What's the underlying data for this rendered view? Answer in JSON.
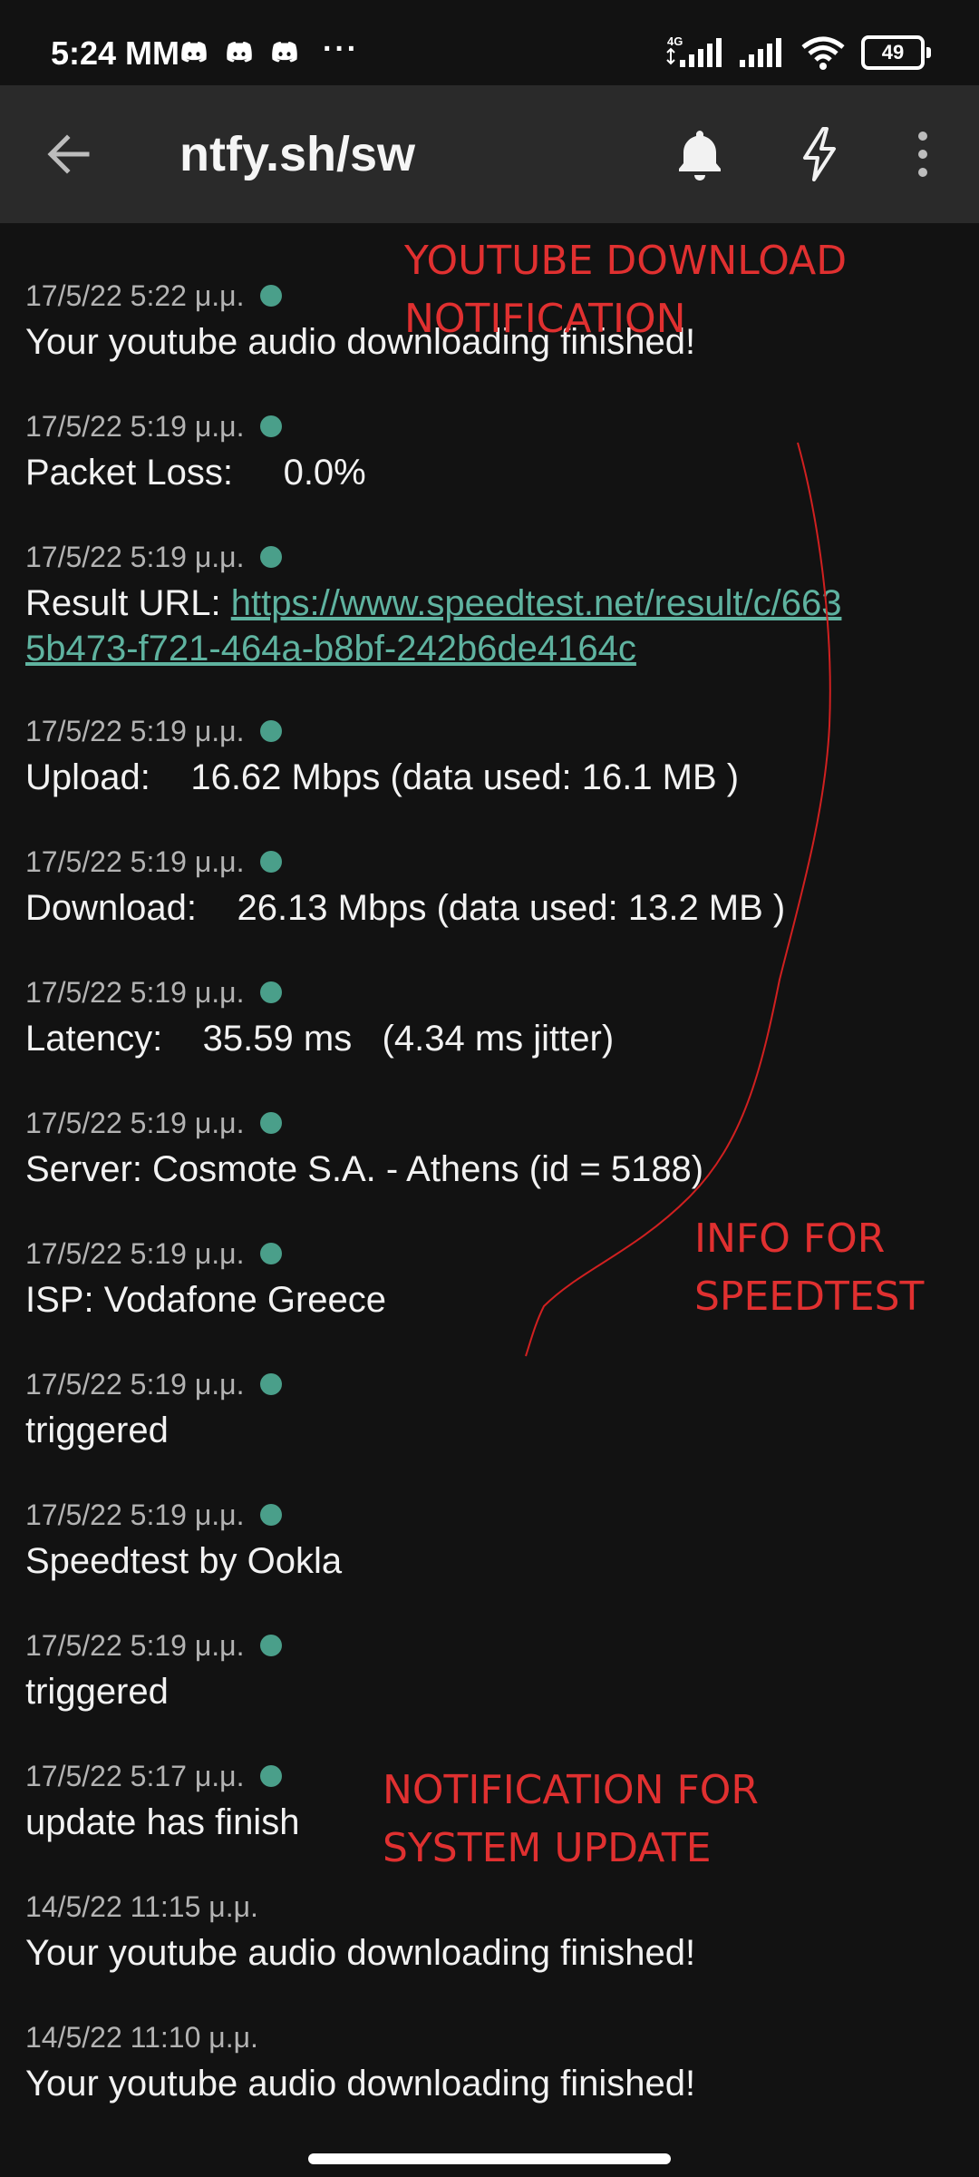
{
  "status_bar": {
    "time": "5:24 MM",
    "more": "···",
    "battery": "49",
    "network_label": "4G"
  },
  "app_bar": {
    "title": "ntfy.sh/sw",
    "back_icon": "arrow-left-icon",
    "bell_icon": "bell-icon",
    "lightning_icon": "lightning-icon",
    "menu_icon": "more-vert-icon"
  },
  "notifications": [
    {
      "timestamp": "17/5/22 5:22 μ.μ.",
      "message": "Your youtube audio downloading finished!",
      "unread": true
    },
    {
      "timestamp": "17/5/22 5:19 μ.μ.",
      "message": "Packet Loss:     0.0%",
      "unread": true
    },
    {
      "timestamp": "17/5/22 5:19 μ.μ.",
      "message_prefix": "Result URL: ",
      "link": "https://www.speedtest.net/result/c/6635b473-f721-464a-b8bf-242b6de4164c",
      "unread": true
    },
    {
      "timestamp": "17/5/22 5:19 μ.μ.",
      "message": "Upload:    16.62 Mbps (data used: 16.1 MB )",
      "unread": true
    },
    {
      "timestamp": "17/5/22 5:19 μ.μ.",
      "message": "Download:    26.13 Mbps (data used: 13.2 MB )",
      "unread": true
    },
    {
      "timestamp": "17/5/22 5:19 μ.μ.",
      "message": "Latency:    35.59 ms   (4.34 ms jitter)",
      "unread": true
    },
    {
      "timestamp": "17/5/22 5:19 μ.μ.",
      "message": "Server: Cosmote S.A. - Athens (id = 5188)",
      "unread": true
    },
    {
      "timestamp": "17/5/22 5:19 μ.μ.",
      "message": "ISP: Vodafone Greece",
      "unread": true
    },
    {
      "timestamp": "17/5/22 5:19 μ.μ.",
      "message": "triggered",
      "unread": true
    },
    {
      "timestamp": "17/5/22 5:19 μ.μ.",
      "message": "Speedtest by Ookla",
      "unread": true
    },
    {
      "timestamp": "17/5/22 5:19 μ.μ.",
      "message": "triggered",
      "unread": true
    },
    {
      "timestamp": "17/5/22 5:17 μ.μ.",
      "message": "update has finish",
      "unread": true
    },
    {
      "timestamp": "14/5/22 11:15 μ.μ.",
      "message": "Your youtube audio downloading finished!",
      "unread": false
    },
    {
      "timestamp": "14/5/22 11:10 μ.μ.",
      "message": "Your youtube audio downloading finished!",
      "unread": false
    }
  ],
  "annotations": {
    "youtube": "YOUTUBE DOWNLOAD\nNOTIFICATION",
    "speedtest": "INFO FOR\nSPEEDTEST",
    "system_update": "NOTIFICATION FOR\nSYSTEM UPDATE"
  },
  "colors": {
    "background": "#121212",
    "app_bar": "#2a2a2a",
    "unread_dot": "#4a9f8a",
    "link": "#5fb3a0",
    "annotation": "#e03030"
  }
}
